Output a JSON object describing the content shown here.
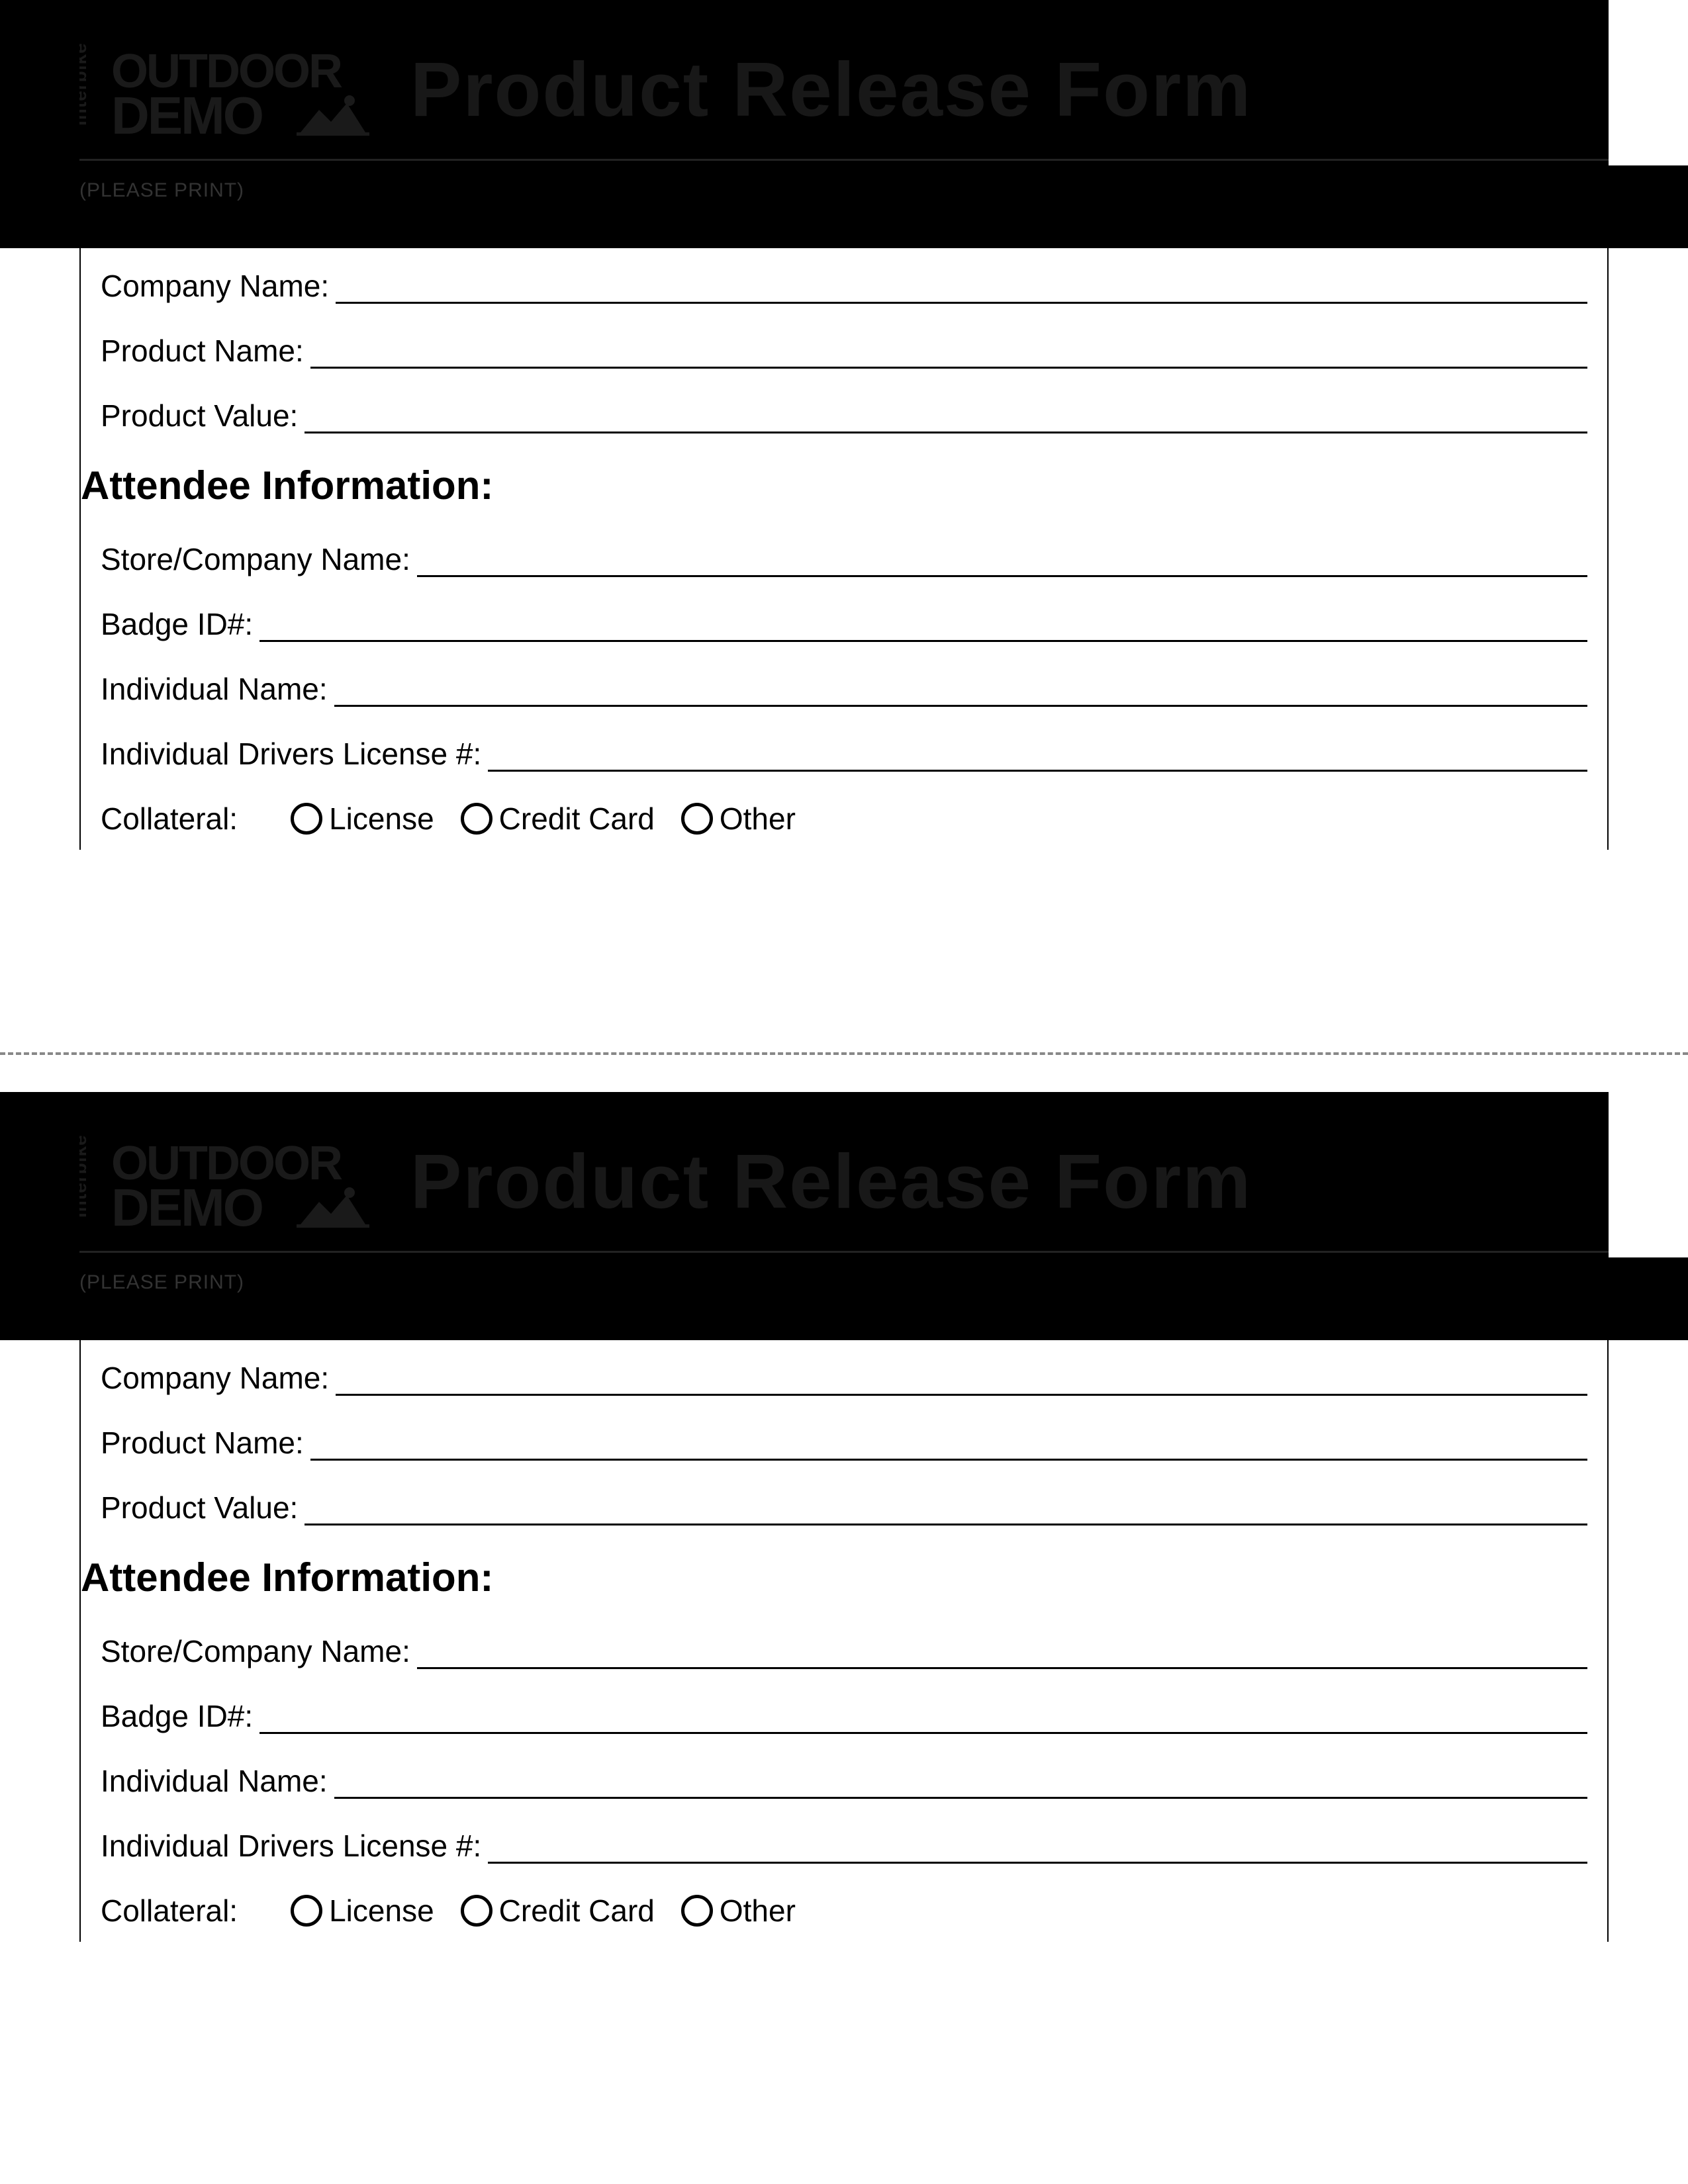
{
  "logo": {
    "vertical": "Interbike",
    "line1": "OUTDOOR",
    "line2": "DEMO"
  },
  "title": "Product Release Form",
  "please_print": "(PLEASE PRINT)",
  "company_info": {
    "company_name_label": "Company Name:",
    "product_name_label": "Product Name:",
    "product_value_label": "Product Value:"
  },
  "attendee_section": {
    "heading": "Attendee Information:",
    "store_company_label": "Store/Company Name:",
    "badge_id_label": "Badge ID#:",
    "individual_name_label": "Individual Name:",
    "drivers_license_label": "Individual Drivers License #:",
    "collateral_label": "Collateral:",
    "options": {
      "license": "License",
      "credit_card": "Credit Card",
      "other": "Other"
    }
  }
}
